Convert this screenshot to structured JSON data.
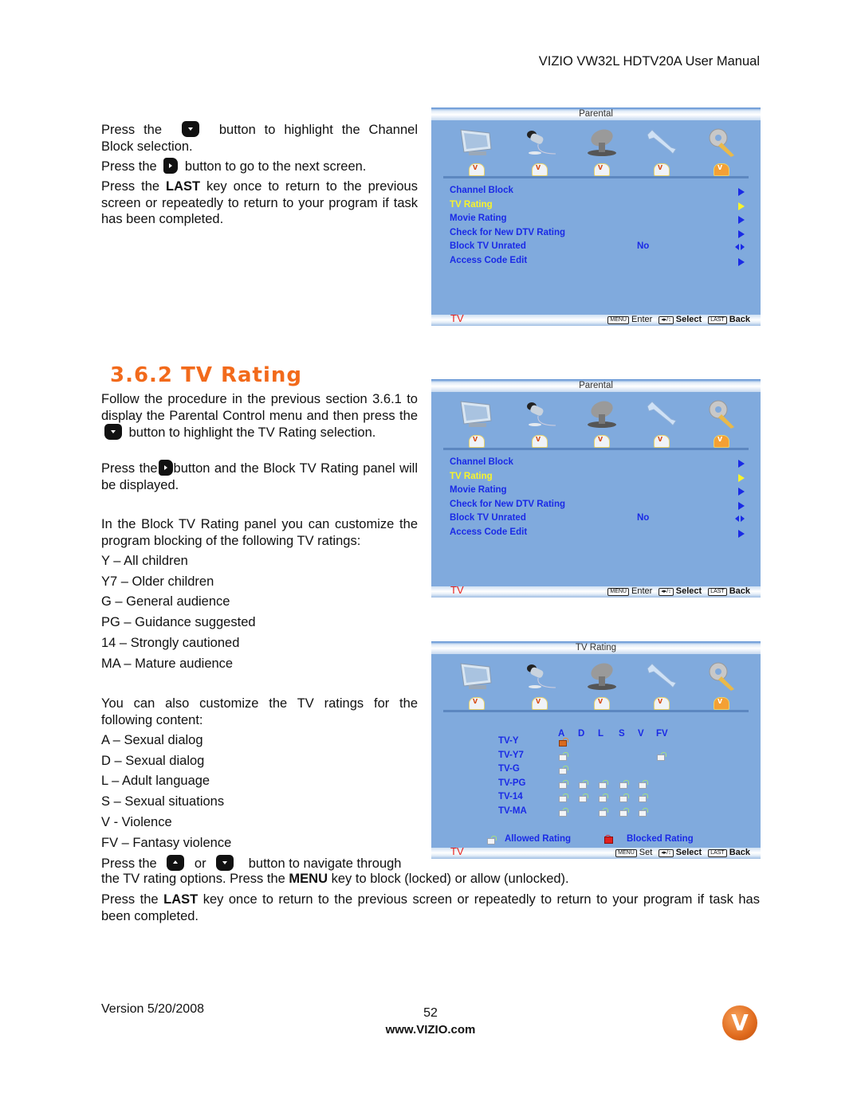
{
  "header": {
    "title": "VIZIO VW32L HDTV20A User Manual"
  },
  "intro": {
    "p1_before": "Press the",
    "p1_after": "button to highlight the Channel Block selection.",
    "p1_icon": "down-key-icon",
    "p2_before": "Press the",
    "p2_after": "button to go to the next screen.",
    "p2_icon": "right-key-icon",
    "p3_before": "Press the ",
    "p3_bold": "LAST",
    "p3_after": " key once to return to the previous screen or repeatedly to return to your program if task has been completed."
  },
  "section": {
    "title": "3.6.2 TV Rating",
    "p1_a": "Follow the procedure in the previous section 3.6.1 to display the Parental Control menu and then press the",
    "p1_b": "button to highlight the TV Rating selection.",
    "p2_a": "Press the",
    "p2_b": "button and the Block TV Rating panel will be displayed.",
    "p3": "In the Block TV Rating panel you can customize the program blocking of the following TV ratings:",
    "ratings": [
      "Y – All children",
      "Y7 – Older children",
      "G – General audience",
      "PG – Guidance suggested",
      "14 – Strongly cautioned",
      "MA – Mature audience"
    ],
    "p4": "You can also customize the TV ratings for the following content:",
    "content": [
      "A – Sexual dialog",
      "D – Sexual dialog",
      "L – Adult language",
      "S – Sexual situations",
      "V - Violence",
      "FV – Fantasy violence"
    ],
    "p5_a": "Press the",
    "p5_or": "or",
    "p5_b": "button to navigate through",
    "p5_c": "the TV rating options.  Press the ",
    "p5_bold": "MENU",
    "p5_d": " key to block (locked) or allow (unlocked).",
    "p6_a": "Press the ",
    "p6_bold": "LAST",
    "p6_b": " key once to return to the previous screen or repeatedly to return to your program if task has been completed."
  },
  "osd_parental": {
    "title": "Parental",
    "icons": [
      "tv-icon",
      "microphone-icon",
      "satellite-dish-icon",
      "wrench-icon",
      "key-icon"
    ],
    "active_icon_index": 4,
    "items": [
      {
        "label": "Channel Block",
        "value": "",
        "arrow": "right"
      },
      {
        "label": "TV Rating",
        "value": "",
        "arrow": "right",
        "selected": true
      },
      {
        "label": "Movie Rating",
        "value": "",
        "arrow": "right"
      },
      {
        "label": "Check for New DTV Rating",
        "value": "",
        "arrow": "right"
      },
      {
        "label": "Block TV Unrated",
        "value": "No",
        "arrow": "left-right"
      },
      {
        "label": "Access Code Edit",
        "value": "",
        "arrow": "right"
      }
    ],
    "footer": {
      "source": "TV",
      "menu_key": "MENU",
      "menu_action": "Enter",
      "nav_key": "◂▸/↕",
      "nav_action": "Select",
      "last_key": "LAST",
      "last_action": "Back"
    }
  },
  "osd_tv_rating": {
    "title": "TV Rating",
    "columns": [
      "A",
      "D",
      "L",
      "S",
      "V",
      "FV"
    ],
    "rows": [
      {
        "label": "TV-Y",
        "cells": [
          "selected",
          "",
          "",
          "",
          "",
          ""
        ]
      },
      {
        "label": "TV-Y7",
        "cells": [
          "allowed",
          "",
          "",
          "",
          "",
          "allowed"
        ]
      },
      {
        "label": "TV-G",
        "cells": [
          "allowed",
          "",
          "",
          "",
          "",
          ""
        ]
      },
      {
        "label": "TV-PG",
        "cells": [
          "allowed",
          "allowed",
          "allowed",
          "allowed",
          "allowed",
          ""
        ]
      },
      {
        "label": "TV-14",
        "cells": [
          "allowed",
          "allowed",
          "allowed",
          "allowed",
          "allowed",
          ""
        ]
      },
      {
        "label": "TV-MA",
        "cells": [
          "allowed",
          "",
          "allowed",
          "allowed",
          "allowed",
          ""
        ]
      }
    ],
    "legend_allowed": "Allowed Rating",
    "legend_blocked": "Blocked Rating",
    "footer": {
      "source": "TV",
      "menu_key": "MENU",
      "menu_action": "Set",
      "nav_key": "◂▸/↕",
      "nav_action": "Select",
      "last_key": "LAST",
      "last_action": "Back"
    }
  },
  "footer": {
    "version": "Version 5/20/2008",
    "page": "52",
    "url": "www.VIZIO.com",
    "logo": "vizio-v-logo"
  },
  "colors": {
    "section_title": "#f26a1b",
    "osd_bg": "#80aadd",
    "osd_text": "#1a2ae6",
    "osd_selected": "#f8f42a",
    "osd_source": "#e8231e"
  }
}
